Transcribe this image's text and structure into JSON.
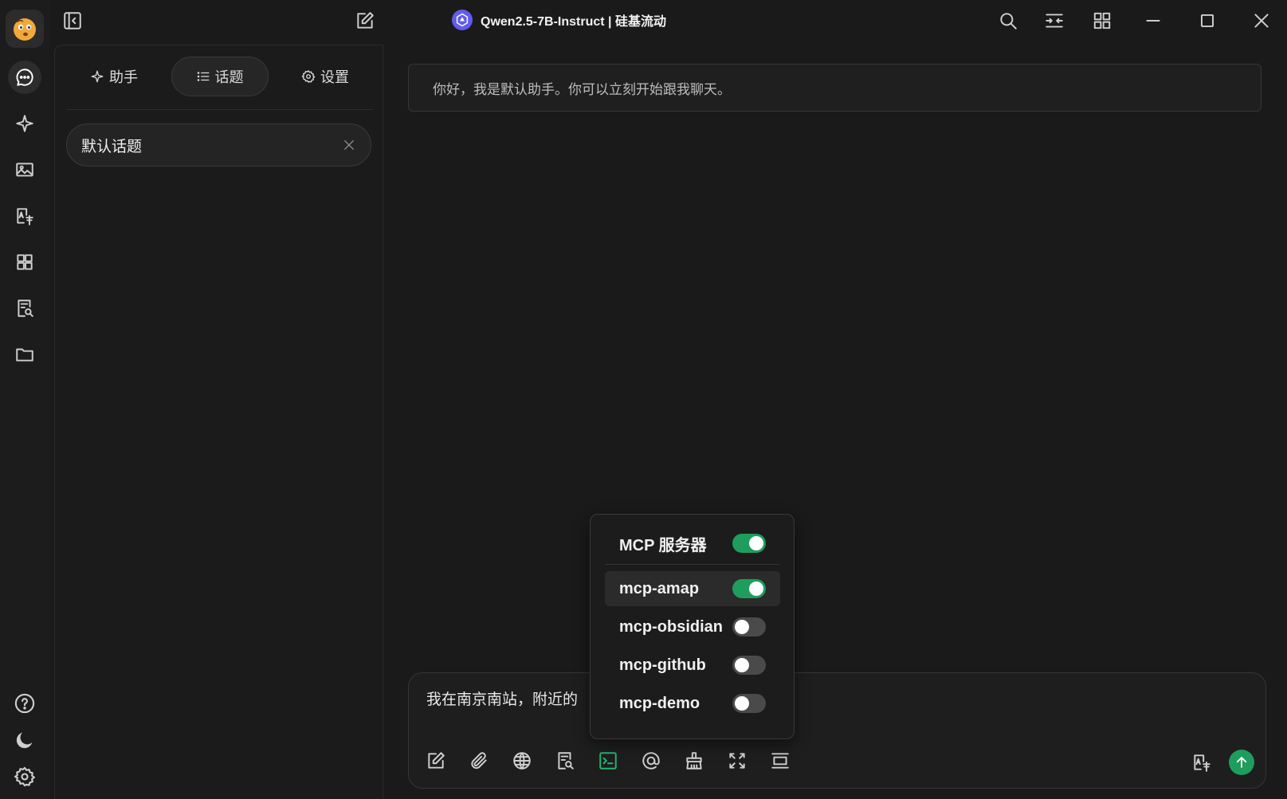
{
  "app": {
    "title": "Qwen2.5-7B-Instruct | 硅基流动"
  },
  "rail": {
    "items": [
      "chat-icon",
      "assistant-star-icon",
      "image-icon",
      "translate-icon",
      "apps-grid-icon",
      "knowledge-search-icon",
      "folder-icon"
    ],
    "bottom": [
      "help-icon",
      "theme-moon-icon",
      "settings-gear-icon"
    ]
  },
  "sidebar": {
    "tabs": [
      {
        "label": "助手",
        "icon": "sparkle-icon"
      },
      {
        "label": "话题",
        "icon": "list-icon"
      },
      {
        "label": "设置",
        "icon": "gear-icon"
      }
    ],
    "active_tab": "话题",
    "topics": [
      {
        "label": "默认话题"
      }
    ]
  },
  "chat": {
    "welcome": "你好，我是默认助手。你可以立刻开始跟我聊天。",
    "input_value": "我在南京南站，附近的"
  },
  "mcp_popover": {
    "header": {
      "label": "MCP 服务器",
      "enabled": true
    },
    "servers": [
      {
        "label": "mcp-amap",
        "enabled": true
      },
      {
        "label": "mcp-obsidian",
        "enabled": false
      },
      {
        "label": "mcp-github",
        "enabled": false
      },
      {
        "label": "mcp-demo",
        "enabled": false
      }
    ]
  },
  "colors": {
    "accent_green": "#1f9d5c",
    "background": "#1a1a1a",
    "title_logo": "#615ced"
  }
}
